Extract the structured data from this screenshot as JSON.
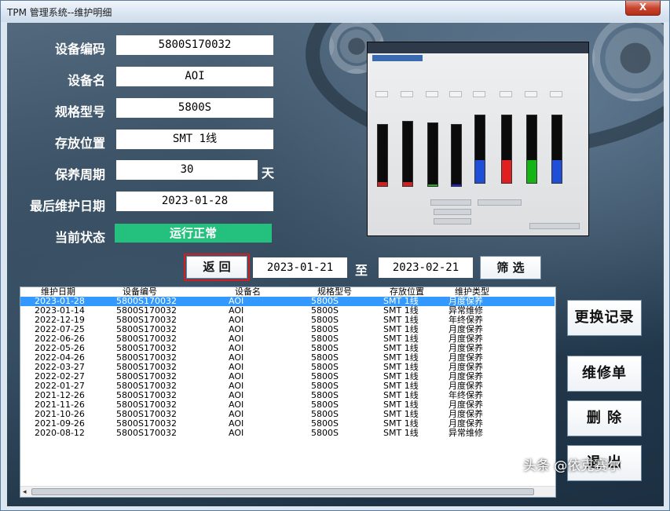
{
  "window": {
    "title": "TPM 管理系统--维护明细",
    "close_label": "X"
  },
  "fields": {
    "device_code": {
      "label": "设备编码",
      "value": "5800S170032"
    },
    "device_name": {
      "label": "设备名",
      "value": "AOI"
    },
    "model": {
      "label": "规格型号",
      "value": "5800S"
    },
    "location": {
      "label": "存放位置",
      "value": "SMT 1线"
    },
    "cycle": {
      "label": "保养周期",
      "value": "30",
      "unit": "天"
    },
    "last_date": {
      "label": "最后维护日期",
      "value": "2023-01-28"
    },
    "status": {
      "label": "当前状态",
      "value": "运行正常",
      "color": "#23c07e"
    }
  },
  "filter": {
    "back_label": "返 回",
    "start_date": "2023-01-21",
    "to_label": "至",
    "end_date": "2023-02-21",
    "filter_label": "筛 选"
  },
  "table": {
    "columns": [
      "维护日期",
      "设备编号",
      "设备名",
      "规格型号",
      "存放位置",
      "维护类型"
    ],
    "rows": [
      [
        "2023-01-28",
        "5800S170032",
        "AOI",
        "5800S",
        "SMT 1线",
        "月度保养"
      ],
      [
        "2023-01-14",
        "5800S170032",
        "AOI",
        "5800S",
        "SMT 1线",
        "异常维修"
      ],
      [
        "2022-12-19",
        "5800S170032",
        "AOI",
        "5800S",
        "SMT 1线",
        "年终保养"
      ],
      [
        "2022-07-25",
        "5800S170032",
        "AOI",
        "5800S",
        "SMT 1线",
        "月度保养"
      ],
      [
        "2022-06-26",
        "5800S170032",
        "AOI",
        "5800S",
        "SMT 1线",
        "月度保养"
      ],
      [
        "2022-05-26",
        "5800S170032",
        "AOI",
        "5800S",
        "SMT 1线",
        "月度保养"
      ],
      [
        "2022-04-26",
        "5800S170032",
        "AOI",
        "5800S",
        "SMT 1线",
        "月度保养"
      ],
      [
        "2022-03-27",
        "5800S170032",
        "AOI",
        "5800S",
        "SMT 1线",
        "月度保养"
      ],
      [
        "2022-02-27",
        "5800S170032",
        "AOI",
        "5800S",
        "SMT 1线",
        "月度保养"
      ],
      [
        "2022-01-27",
        "5800S170032",
        "AOI",
        "5800S",
        "SMT 1线",
        "月度保养"
      ],
      [
        "2021-12-26",
        "5800S170032",
        "AOI",
        "5800S",
        "SMT 1线",
        "年终保养"
      ],
      [
        "2021-11-26",
        "5800S170032",
        "AOI",
        "5800S",
        "SMT 1线",
        "月度保养"
      ],
      [
        "2021-10-26",
        "5800S170032",
        "AOI",
        "5800S",
        "SMT 1线",
        "月度保养"
      ],
      [
        "2021-09-26",
        "5800S170032",
        "AOI",
        "5800S",
        "SMT 1线",
        "月度保养"
      ],
      [
        "2020-08-12",
        "5800S170032",
        "AOI",
        "5800S",
        "SMT 1线",
        "异常维修"
      ]
    ],
    "selected_row": 0,
    "selection_color": "#3399ff"
  },
  "actions": {
    "replace_record": "更换记录",
    "repair_order": "维修单",
    "delete": "删 除",
    "exit": "退 出"
  },
  "watermark": "头条 @依克赛尔"
}
